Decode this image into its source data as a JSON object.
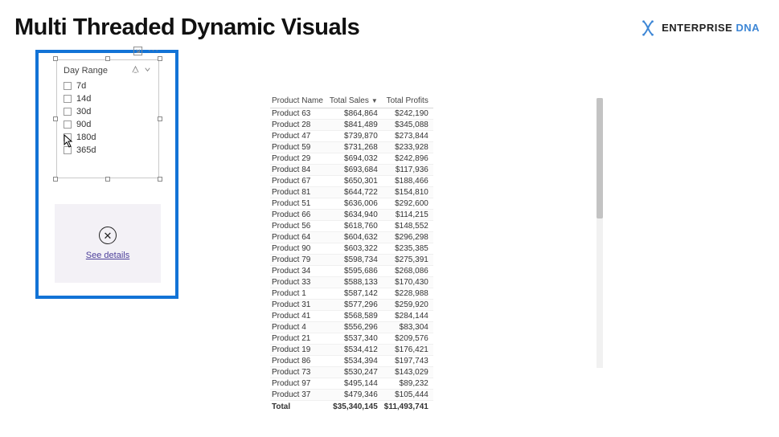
{
  "header": {
    "title": "Multi Threaded Dynamic Visuals",
    "logo_text1": "ENTERPRISE",
    "logo_text2": "DNA"
  },
  "slicer": {
    "title": "Day Range",
    "items": [
      {
        "label": "7d"
      },
      {
        "label": "14d"
      },
      {
        "label": "30d"
      },
      {
        "label": "90d"
      },
      {
        "label": "180d"
      },
      {
        "label": "365d"
      }
    ]
  },
  "error_card": {
    "link": "See details",
    "icon_label": "✕"
  },
  "table": {
    "columns": {
      "product": "Product Name",
      "sales": "Total Sales",
      "profits": "Total Profits"
    },
    "rows": [
      {
        "name": "Product 63",
        "sales": "$864,864",
        "profits": "$242,190"
      },
      {
        "name": "Product 28",
        "sales": "$841,489",
        "profits": "$345,088"
      },
      {
        "name": "Product 47",
        "sales": "$739,870",
        "profits": "$273,844"
      },
      {
        "name": "Product 59",
        "sales": "$731,268",
        "profits": "$233,928"
      },
      {
        "name": "Product 29",
        "sales": "$694,032",
        "profits": "$242,896"
      },
      {
        "name": "Product 84",
        "sales": "$693,684",
        "profits": "$117,936"
      },
      {
        "name": "Product 67",
        "sales": "$650,301",
        "profits": "$188,466"
      },
      {
        "name": "Product 81",
        "sales": "$644,722",
        "profits": "$154,810"
      },
      {
        "name": "Product 51",
        "sales": "$636,006",
        "profits": "$292,600"
      },
      {
        "name": "Product 66",
        "sales": "$634,940",
        "profits": "$114,215"
      },
      {
        "name": "Product 56",
        "sales": "$618,760",
        "profits": "$148,552"
      },
      {
        "name": "Product 64",
        "sales": "$604,632",
        "profits": "$296,298"
      },
      {
        "name": "Product 90",
        "sales": "$603,322",
        "profits": "$235,385"
      },
      {
        "name": "Product 79",
        "sales": "$598,734",
        "profits": "$275,391"
      },
      {
        "name": "Product 34",
        "sales": "$595,686",
        "profits": "$268,086"
      },
      {
        "name": "Product 33",
        "sales": "$588,133",
        "profits": "$170,430"
      },
      {
        "name": "Product 1",
        "sales": "$587,142",
        "profits": "$228,988"
      },
      {
        "name": "Product 31",
        "sales": "$577,296",
        "profits": "$259,920"
      },
      {
        "name": "Product 41",
        "sales": "$568,589",
        "profits": "$284,144"
      },
      {
        "name": "Product 4",
        "sales": "$556,296",
        "profits": "$83,304"
      },
      {
        "name": "Product 21",
        "sales": "$537,340",
        "profits": "$209,576"
      },
      {
        "name": "Product 19",
        "sales": "$534,412",
        "profits": "$176,421"
      },
      {
        "name": "Product 86",
        "sales": "$534,394",
        "profits": "$197,743"
      },
      {
        "name": "Product 73",
        "sales": "$530,247",
        "profits": "$143,029"
      },
      {
        "name": "Product 97",
        "sales": "$495,144",
        "profits": "$89,232"
      },
      {
        "name": "Product 37",
        "sales": "$479,346",
        "profits": "$105,444"
      }
    ],
    "total": {
      "label": "Total",
      "sales": "$35,340,145",
      "profits": "$11,493,741"
    }
  }
}
